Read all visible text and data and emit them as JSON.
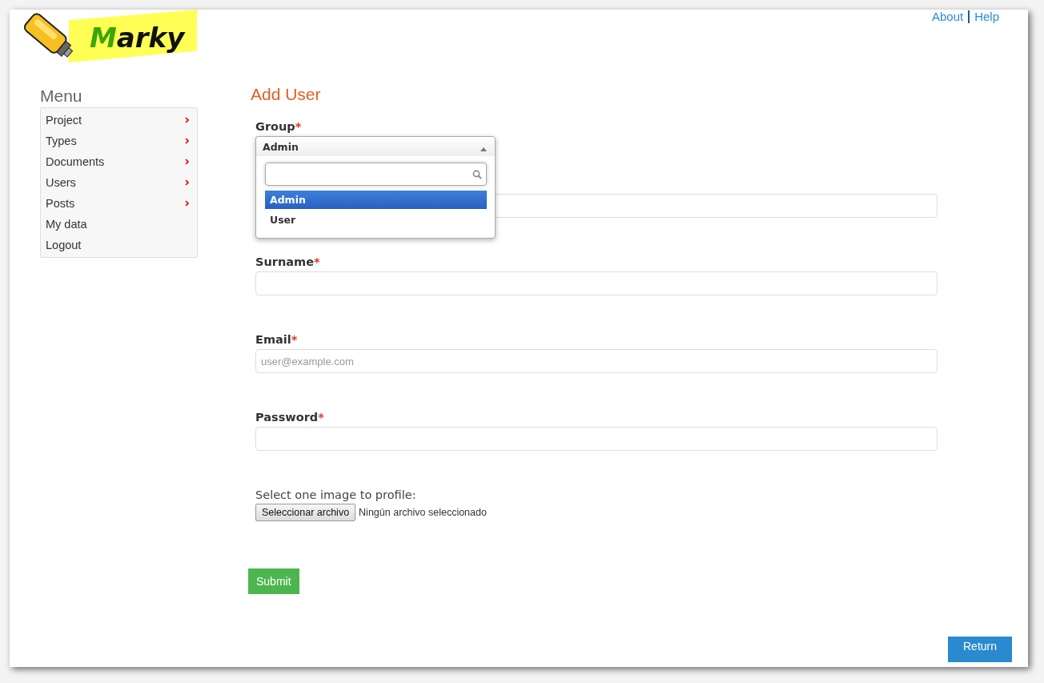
{
  "logo": {
    "text": "Marky"
  },
  "top_links": [
    {
      "label": "About"
    },
    {
      "label": "Help"
    }
  ],
  "menu": {
    "title": "Menu",
    "items": [
      {
        "label": "Project",
        "has_submenu": true
      },
      {
        "label": "Types",
        "has_submenu": true
      },
      {
        "label": "Documents",
        "has_submenu": true
      },
      {
        "label": "Users",
        "has_submenu": true
      },
      {
        "label": "Posts",
        "has_submenu": true
      },
      {
        "label": "My data",
        "has_submenu": false
      },
      {
        "label": "Logout",
        "has_submenu": false
      }
    ]
  },
  "form": {
    "title": "Add User",
    "group": {
      "label": "Group",
      "required_mark": "*",
      "value": "Admin",
      "expanded": true,
      "options": [
        {
          "label": "Admin",
          "selected": true
        },
        {
          "label": "User",
          "selected": false
        }
      ]
    },
    "fields": [
      {
        "label": "Surname",
        "required_mark": "*"
      },
      {
        "label": "Email",
        "required_mark": "*",
        "placeholder": "user@example.com"
      },
      {
        "label": "Password",
        "required_mark": "*"
      }
    ],
    "file": {
      "label": "Select one image to profile:",
      "button": "Seleccionar archivo",
      "status": "Ningún archivo seleccionado"
    },
    "submit": "Submit"
  },
  "return_button": "Return"
}
